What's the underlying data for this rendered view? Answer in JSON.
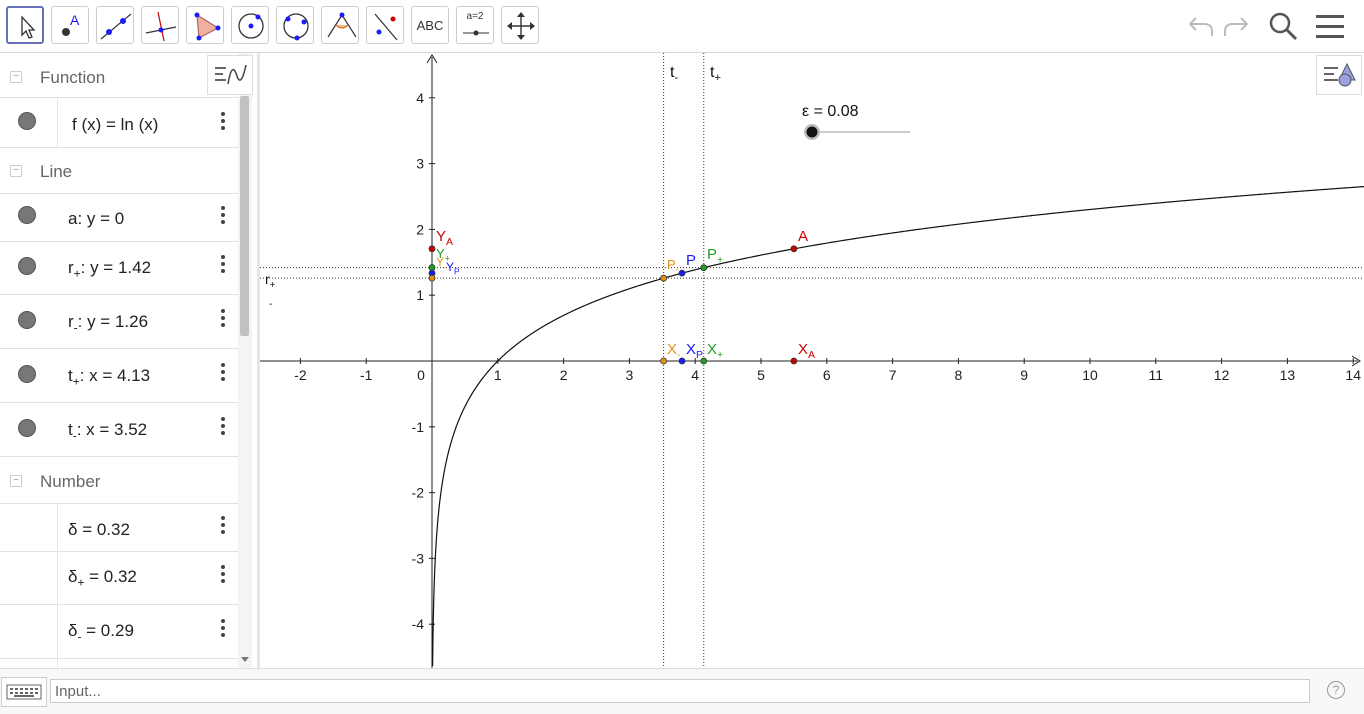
{
  "toolbar": {
    "tools": [
      {
        "name": "move-tool",
        "icon": "arrow-cursor-icon"
      },
      {
        "name": "point-tool",
        "icon": "point-icon",
        "label": "A"
      },
      {
        "name": "line-tool",
        "icon": "line-icon"
      },
      {
        "name": "perpendicular-tool",
        "icon": "perpendicular-line-icon"
      },
      {
        "name": "polygon-tool",
        "icon": "polygon-icon"
      },
      {
        "name": "circle-center-point-tool",
        "icon": "circle-icon"
      },
      {
        "name": "circle-three-points-tool",
        "icon": "circle-three-points-icon"
      },
      {
        "name": "angle-tool",
        "icon": "angle-icon"
      },
      {
        "name": "reflect-tool",
        "icon": "reflect-icon"
      },
      {
        "name": "text-tool",
        "icon": "text-icon",
        "label": "ABC"
      },
      {
        "name": "slider-tool",
        "icon": "slider-icon",
        "label": "a=2"
      },
      {
        "name": "move-graphics-tool",
        "icon": "move-view-icon"
      }
    ]
  },
  "algebra": {
    "sections": {
      "function": {
        "title": "Function"
      },
      "line": {
        "title": "Line"
      },
      "number": {
        "title": "Number"
      }
    },
    "rows": {
      "f": {
        "lhs": "f (x)",
        "eq": " = ",
        "rhs": "ln (x)"
      },
      "a": {
        "name": "a",
        "rest": ": y = 0"
      },
      "rplus": {
        "name": "r",
        "sub": "+",
        "rest": ": y = 1.42"
      },
      "rminus": {
        "name": "r",
        "sub": "-",
        "rest": ": y = 1.26"
      },
      "tplus": {
        "name": "t",
        "sub": "+",
        "rest": ": x = 4.13"
      },
      "tminus": {
        "name": "t",
        "sub": "-",
        "rest": ": x = 3.52"
      },
      "delta": {
        "name": "δ",
        "sub": "",
        "rest": " = 0.32"
      },
      "deltaplus": {
        "name": "δ",
        "sub": "+",
        "rest": " = 0.32"
      },
      "deltaminus": {
        "name": "δ",
        "sub": "-",
        "rest": " = 0.29"
      }
    }
  },
  "graph": {
    "xticks": [
      "-2",
      "-1",
      "0",
      "1",
      "2",
      "3",
      "4",
      "5",
      "6",
      "7",
      "8",
      "9",
      "10",
      "11",
      "12",
      "13",
      "14"
    ],
    "yticks": [
      "4",
      "3",
      "2",
      "1",
      "-1",
      "-2",
      "-3",
      "-4"
    ],
    "labels": {
      "tminus": {
        "base": "t",
        "sub": "-"
      },
      "tplus": {
        "base": "t",
        "sub": "+"
      },
      "rlabel": {
        "base": "r",
        "sub": "+",
        "sub2": "-"
      },
      "A": "A",
      "XA": {
        "base": "X",
        "sub": "A"
      },
      "YA": {
        "base": "Y",
        "sub": "A"
      },
      "P": "P",
      "Pplus": {
        "base": "P",
        "sub": "+"
      },
      "Pminus": {
        "base": "P",
        "sub": "-"
      },
      "X": {
        "base": "X",
        "sub": "-"
      },
      "XP": {
        "base": "X",
        "sub": "P"
      },
      "Xplus": {
        "base": "X",
        "sub": "+"
      },
      "Yplus": {
        "base": "Y",
        "sub": "+"
      },
      "Yminus": {
        "base": "Y",
        "sub": "-"
      },
      "YP": {
        "base": "Y",
        "sub": "P"
      }
    },
    "slider": {
      "label": "ε = 0.08",
      "value": 0.08
    },
    "values": {
      "t_plus": 4.13,
      "t_minus": 3.52,
      "r_plus": 1.42,
      "r_minus": 1.26,
      "A_x": 5.5,
      "P_x": 3.8
    }
  },
  "input": {
    "placeholder": "Input..."
  },
  "help": {
    "label": "?"
  },
  "colors": {
    "red": "#cc0000",
    "green": "#1ea01e",
    "blue": "#1a1aff",
    "orange": "#e69112",
    "active": "#6670b4"
  }
}
